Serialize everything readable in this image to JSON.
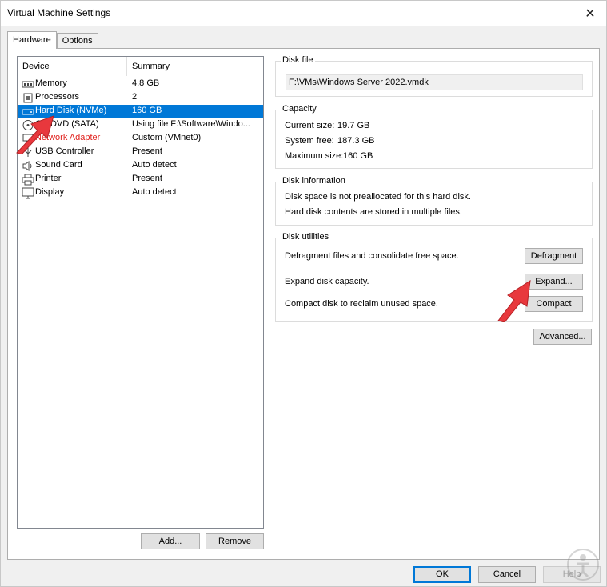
{
  "window": {
    "title": "Virtual Machine Settings",
    "close_label": "✕"
  },
  "tabs": [
    {
      "label": "Hardware"
    },
    {
      "label": "Options"
    }
  ],
  "device_list": {
    "headers": {
      "device": "Device",
      "summary": "Summary"
    },
    "rows": [
      {
        "device": "Memory",
        "summary": "4.8 GB",
        "icon": "memory-icon"
      },
      {
        "device": "Processors",
        "summary": "2",
        "icon": "processor-icon"
      },
      {
        "device": "Hard Disk (NVMe)",
        "summary": "160 GB",
        "icon": "hard-disk-icon"
      },
      {
        "device": "CD/DVD (SATA)",
        "summary": "Using file F:\\Software\\Windo...",
        "icon": "cd-dvd-icon"
      },
      {
        "device": "Network Adapter",
        "summary": "Custom (VMnet0)",
        "icon": "network-adapter-icon"
      },
      {
        "device": "USB Controller",
        "summary": "Present",
        "icon": "usb-icon"
      },
      {
        "device": "Sound Card",
        "summary": "Auto detect",
        "icon": "speaker-icon"
      },
      {
        "device": "Printer",
        "summary": "Present",
        "icon": "printer-icon"
      },
      {
        "device": "Display",
        "summary": "Auto detect",
        "icon": "display-icon"
      }
    ],
    "selected_index": 2,
    "add_label": "Add...",
    "remove_label": "Remove"
  },
  "disk_file": {
    "label": "Disk file",
    "path": "F:\\VMs\\Windows Server 2022.vmdk"
  },
  "capacity": {
    "label": "Capacity",
    "current_label": "Current size:",
    "current_value": "19.7 GB",
    "free_label": "System free:",
    "free_value": "187.3 GB",
    "max_label": "Maximum size:",
    "max_value": "160 GB"
  },
  "disk_info": {
    "label": "Disk information",
    "line1": "Disk space is not preallocated for this hard disk.",
    "line2": "Hard disk contents are stored in multiple files."
  },
  "disk_utilities": {
    "label": "Disk utilities",
    "defrag_text": "Defragment files and consolidate free space.",
    "defrag_button": "Defragment",
    "expand_text": "Expand disk capacity.",
    "expand_button": "Expand...",
    "compact_text": "Compact disk to reclaim unused space.",
    "compact_button": "Compact"
  },
  "advanced_button": "Advanced...",
  "footer": {
    "ok": "OK",
    "cancel": "Cancel",
    "help": "Help"
  },
  "colors": {
    "selection": "#0078d7",
    "annotation_arrow": "#e8383d"
  }
}
